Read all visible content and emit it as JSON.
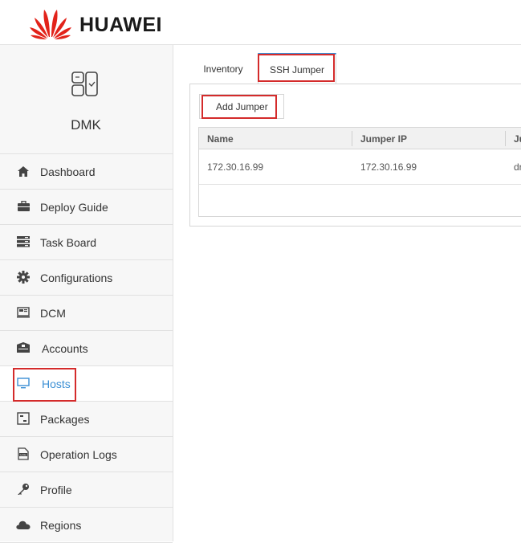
{
  "header": {
    "brand": "HUAWEI",
    "logo_icon": "huawei-petal-logo",
    "logo_color": "#e2231a"
  },
  "sidebar": {
    "app_name": "DMK",
    "app_icon": "dmk-app-icon",
    "accent": "#3b8fd4",
    "items": [
      {
        "label": "Dashboard",
        "icon": "home-icon"
      },
      {
        "label": "Deploy Guide",
        "icon": "briefcase-icon"
      },
      {
        "label": "Task Board",
        "icon": "server-stack-icon"
      },
      {
        "label": "Configurations",
        "icon": "gear-icon"
      },
      {
        "label": "DCM",
        "icon": "dcm-icon"
      },
      {
        "label": "Accounts",
        "icon": "accounts-box-icon"
      },
      {
        "label": "Hosts",
        "icon": "monitor-icon"
      },
      {
        "label": "Packages",
        "icon": "package-icon"
      },
      {
        "label": "Operation Logs",
        "icon": "log-file-icon"
      },
      {
        "label": "Profile",
        "icon": "key-icon"
      },
      {
        "label": "Regions",
        "icon": "cloud-icon"
      }
    ],
    "active_item": "Hosts"
  },
  "main": {
    "tabs": [
      {
        "label": "Inventory"
      },
      {
        "label": "SSH Jumper"
      }
    ],
    "active_tab": "SSH Jumper",
    "toolbar": {
      "add_label": "Add Jumper"
    },
    "table": {
      "columns": [
        "Name",
        "Jumper IP",
        "Ju"
      ],
      "rows": [
        [
          "172.30.16.99",
          "172.30.16.99",
          "dr"
        ]
      ]
    },
    "highlight_color": "#d42b2b"
  }
}
